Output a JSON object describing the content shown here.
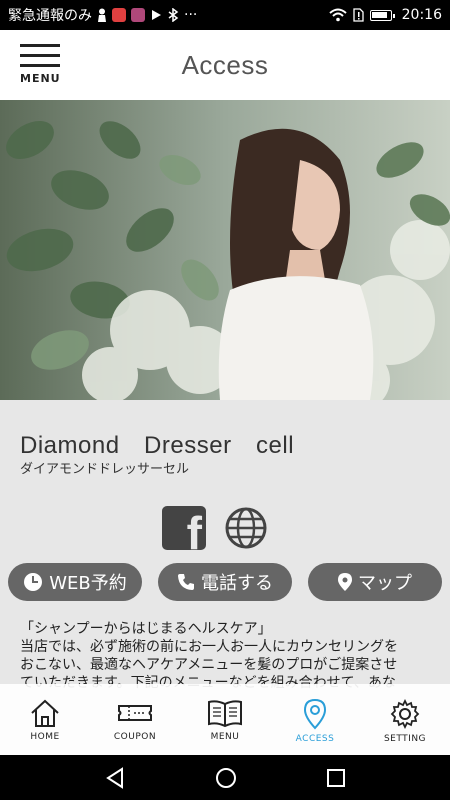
{
  "status_bar": {
    "notification_text": "緊急通報のみ",
    "time": "20:16"
  },
  "header": {
    "menu_label": "MENU",
    "title": "Access"
  },
  "shop": {
    "name": "Diamond　Dresser　cell",
    "kana": "ダイアモンドドレッサーセル"
  },
  "actions": {
    "web": "WEB予約",
    "tel": "電話する",
    "map": "マップ"
  },
  "description": {
    "line1": "「シャンプーからはじまるヘルスケア」",
    "line2": "当店では、必ず施術の前にお一人お一人にカウンセリングを",
    "line3": "おこない、最適なヘアケアメニューを髪のプロがご提案させ",
    "line4": "ていただきます。下記のメニューなどを組み合わせて、あな"
  },
  "tabs": [
    {
      "label": "HOME",
      "icon": "home-icon"
    },
    {
      "label": "COUPON",
      "icon": "ticket-icon"
    },
    {
      "label": "MENU",
      "icon": "book-icon"
    },
    {
      "label": "ACCESS",
      "icon": "location-pin-icon",
      "active": true
    },
    {
      "label": "SETTING",
      "icon": "gear-icon"
    }
  ],
  "colors": {
    "accent": "#2a9ed8",
    "pill_bg": "#666666",
    "page_bg": "#e7e7e7"
  }
}
